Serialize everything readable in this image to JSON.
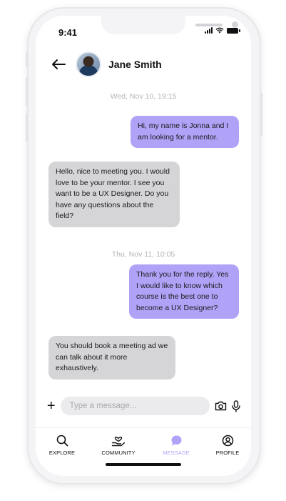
{
  "status": {
    "time": "9:41"
  },
  "header": {
    "contact_name": "Jane Smith"
  },
  "conversation": [
    {
      "type": "timestamp",
      "text": "Wed, Nov 10, 19:15"
    },
    {
      "type": "outgoing",
      "text": "Hi, my name is Jonna and I am looking for a mentor."
    },
    {
      "type": "incoming",
      "text": "Hello, nice to meeting you. I would love to be your mentor. I see you want to be a UX Designer. Do you have any questions about the field?"
    },
    {
      "type": "timestamp",
      "text": "Thu, Nov 11, 10:05"
    },
    {
      "type": "outgoing",
      "text": "Thank you for the reply. Yes I would like to know which course is the best one to become a UX Designer?"
    },
    {
      "type": "incoming",
      "text": "You should book a meeting ad we can talk about it more exhaustively."
    }
  ],
  "composer": {
    "placeholder": "Type a message..."
  },
  "tabs": [
    {
      "label": "EXPLORE",
      "icon": "search-icon",
      "active": false
    },
    {
      "label": "COMMUNITY",
      "icon": "community-icon",
      "active": false
    },
    {
      "label": "MESSAGE",
      "icon": "message-icon",
      "active": true
    },
    {
      "label": "PROFILE",
      "icon": "profile-icon",
      "active": false
    }
  ],
  "colors": {
    "accent": "#b0a2f7",
    "incoming_bubble": "#d5d5d7",
    "timestamp": "#b4b4b8"
  }
}
